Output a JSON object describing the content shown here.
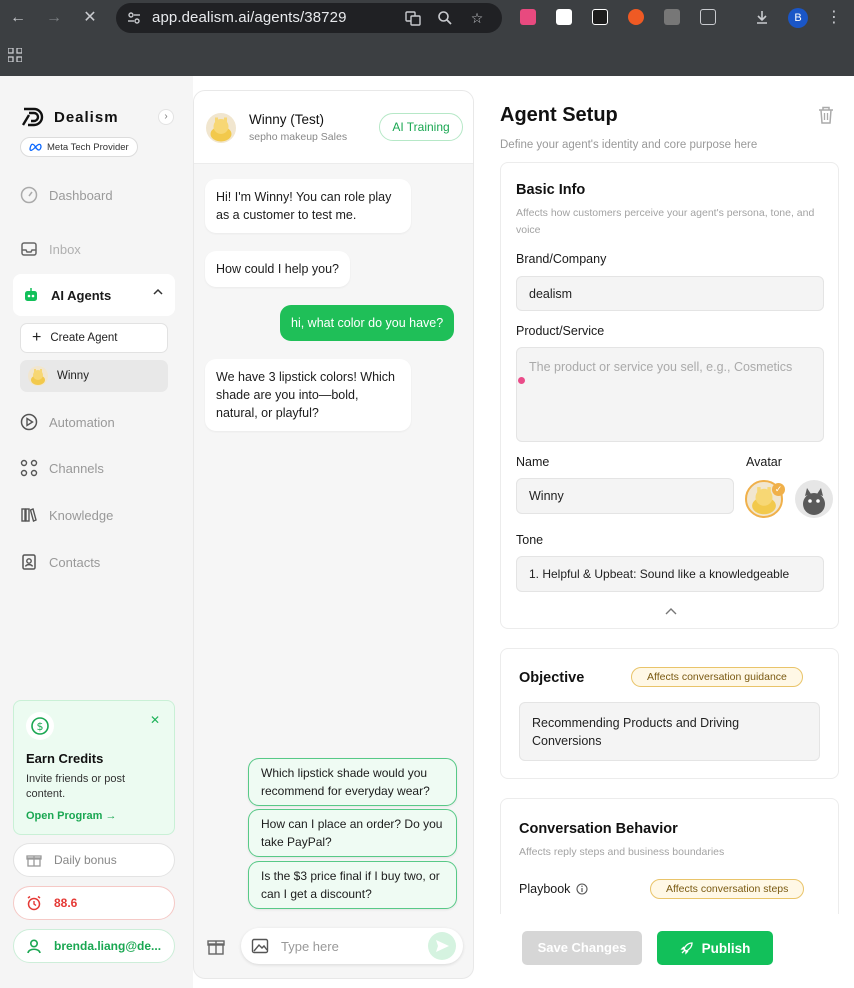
{
  "browser": {
    "url": "app.dealism.ai/agents/38729",
    "profile_initial": "B"
  },
  "sidebar": {
    "brand": "Dealism",
    "meta_badge": "Meta Tech Provider",
    "nav": {
      "dashboard": "Dashboard",
      "inbox": "Inbox",
      "ai_agents": "AI Agents",
      "automation": "Automation",
      "channels": "Channels",
      "knowledge": "Knowledge",
      "contacts": "Contacts"
    },
    "create_agent": "Create Agent",
    "agent_item": "Winny",
    "credits": {
      "title": "Earn Credits",
      "desc": "Invite friends or post content.",
      "link": "Open Program →"
    },
    "daily_bonus": "Daily bonus",
    "score": "88.6",
    "user_email": "brenda.liang@de..."
  },
  "chat": {
    "agent_name": "Winny (Test)",
    "agent_sub": "sepho makeup Sales",
    "training_label": "AI Training",
    "messages": [
      {
        "from": "bot",
        "text": "Hi! I'm Winny! You can role play as a customer to test me."
      },
      {
        "from": "bot",
        "text": "How could I help you?"
      },
      {
        "from": "user",
        "text": "hi, what color do you have?"
      },
      {
        "from": "bot",
        "text": "We have 3 lipstick colors! Which shade are you into—bold, natural, or playful?"
      }
    ],
    "suggestions": [
      "Which lipstick shade would you recommend for everyday wear?",
      "How can I place an order? Do you take PayPal?",
      "Is the $3 price final if I buy two, or can I get a discount?"
    ],
    "input_placeholder": "Type here"
  },
  "setup": {
    "title": "Agent Setup",
    "subtitle": "Define your agent's identity and core purpose here",
    "basic": {
      "title": "Basic Info",
      "desc": "Affects how customers perceive your agent's persona, tone, and voice",
      "brand_label": "Brand/Company",
      "brand_value": "dealism",
      "product_label": "Product/Service",
      "product_placeholder": "The product or service you sell, e.g., Cosmetics",
      "name_label": "Name",
      "name_value": "Winny",
      "avatar_label": "Avatar",
      "tone_label": "Tone",
      "tone_value": "1. Helpful & Upbeat: Sound like a knowledgeable"
    },
    "objective": {
      "title": "Objective",
      "tag": "Affects conversation guidance",
      "value": "Recommending Products and Driving Conversions"
    },
    "behavior": {
      "title": "Conversation Behavior",
      "desc": "Affects reply steps and business boundaries",
      "playbook_label": "Playbook",
      "tag": "Affects conversation steps"
    },
    "save_label": "Save Changes",
    "publish_label": "Publish"
  },
  "colors": {
    "brand_green": "#12c05a",
    "sidebar_bg": "#f5f5f5",
    "tag_yellow": "#e9c46a",
    "score_red": "#e53935"
  }
}
